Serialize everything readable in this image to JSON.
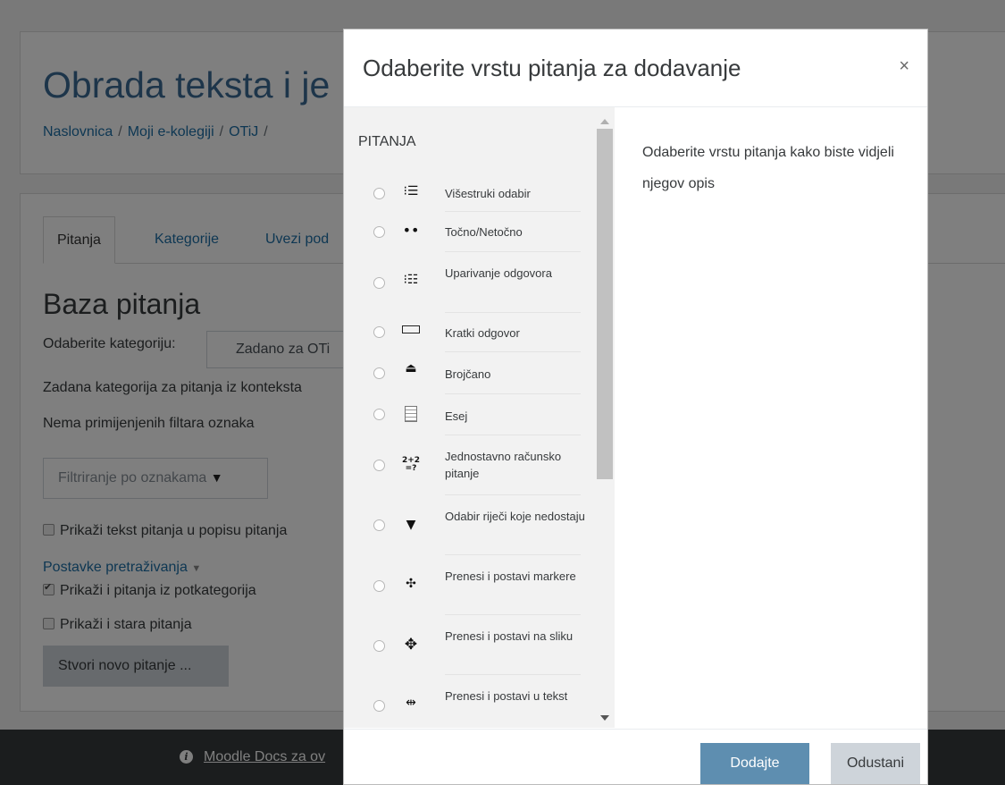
{
  "page": {
    "course_title": "Obrada teksta i je",
    "breadcrumb": [
      "Naslovnica",
      "Moji e-kolegiji",
      "OTiJ",
      ""
    ],
    "tabs": [
      "Pitanja",
      "Kategorije",
      "Uvezi pod"
    ],
    "bank_title": "Baza pitanja",
    "category_label": "Odaberite kategoriju:",
    "category_value": "Zadano za OTi",
    "default_category_text": "Zadana kategorija za pitanja iz konteksta",
    "no_filters_text": "Nema primijenjenih filtara oznaka",
    "filter_placeholder": "Filtriranje po oznakama",
    "show_question_text": "Prikaži tekst pitanja u popisu pitanja",
    "search_settings": "Postavke pretraživanja",
    "show_subcategories": "Prikaži i pitanja iz potkategorija",
    "show_old": "Prikaži i stara pitanja",
    "create_button": "Stvori novo pitanje ...",
    "footer_link": "Moodle Docs za ov"
  },
  "modal": {
    "title": "Odaberite vrstu pitanja za dodavanje",
    "close": "×",
    "list_heading": "PITANJA",
    "description": "Odaberite vrstu pitanja kako biste vidjeli njegov opis",
    "items": [
      {
        "label": "Višestruki odabir",
        "icon": "multichoice-icon"
      },
      {
        "label": "Točno/Netočno",
        "icon": "truefalse-icon"
      },
      {
        "label": "Uparivanje odgovora",
        "icon": "matching-icon"
      },
      {
        "label": "Kratki odgovor",
        "icon": "shortanswer-icon"
      },
      {
        "label": "Brojčano",
        "icon": "numerical-icon"
      },
      {
        "label": "Esej",
        "icon": "essay-icon"
      },
      {
        "label": "Jednostavno računsko pitanje",
        "icon": "calculated-simple-icon"
      },
      {
        "label": "Odabir riječi koje nedostaju",
        "icon": "select-missing-words-icon"
      },
      {
        "label": "Prenesi i postavi markere",
        "icon": "drag-drop-markers-icon"
      },
      {
        "label": "Prenesi i postavi na sliku",
        "icon": "drag-drop-image-icon"
      },
      {
        "label": "Prenesi i postavi u tekst",
        "icon": "drag-drop-text-icon"
      }
    ],
    "add_button": "Dodajte",
    "cancel_button": "Odustani"
  }
}
